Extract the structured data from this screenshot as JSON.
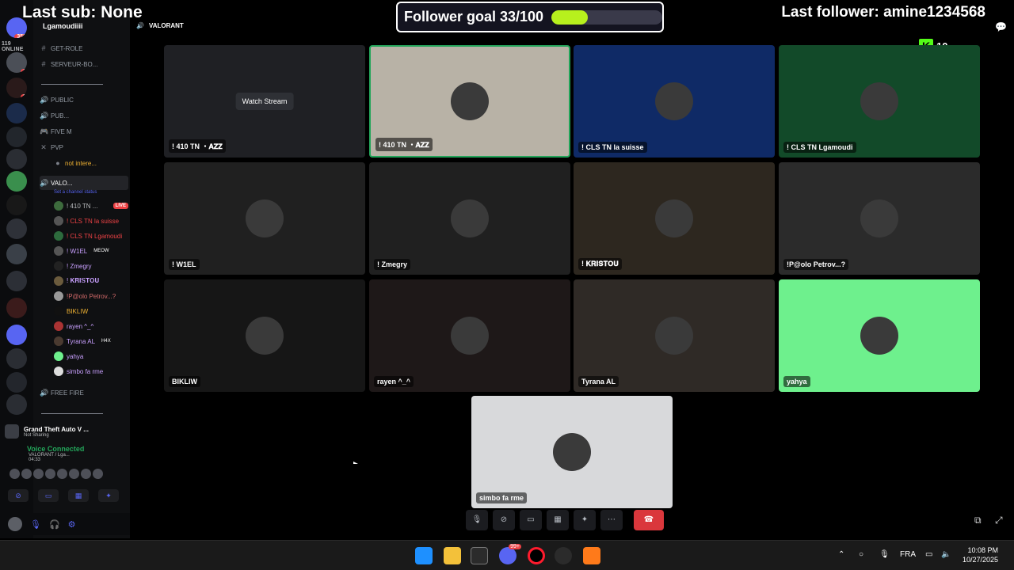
{
  "overlay": {
    "last_sub": "Last sub: None",
    "last_follower": "Last follower: amine1234568",
    "follower_goal": "Follower goal 33/100",
    "goal_progress": 0.33,
    "kick_count": "10"
  },
  "rail": {
    "online_label": "119 ONLINE",
    "top_badge": "359",
    "second_badge": "1",
    "third_badge": "3"
  },
  "server": {
    "name": "Lgamoudiiii"
  },
  "channels": [
    {
      "label": "GET-ROLE"
    },
    {
      "label": "SERVEUR-BO..."
    },
    {
      "label": "PUBLIC"
    },
    {
      "label": "PUB..."
    },
    {
      "label": "FIVE M"
    },
    {
      "label": "PVP"
    },
    {
      "label": "not intere..."
    },
    {
      "label": "VALO..."
    },
    {
      "label": "FREE FIRE"
    }
  ],
  "channel_status": "Set a channel status",
  "members": [
    {
      "name": "! 410 TN ...",
      "tag": "LIVE"
    },
    {
      "name": "! CLS TN la suisse",
      "tag": ""
    },
    {
      "name": "! CLS TN Lgamoudi",
      "tag": ""
    },
    {
      "name": "! W1EL",
      "tag": "MEOW"
    },
    {
      "name": "! Zmegry",
      "tag": ""
    },
    {
      "name": "! 𝐊𝐑𝐈𝐒𝐓𝐎𝐔",
      "tag": ""
    },
    {
      "name": "!P@olo Petrov...?",
      "tag": ""
    },
    {
      "name": "BIKLIW",
      "tag": ""
    },
    {
      "name": "rayen ^_^",
      "tag": ""
    },
    {
      "name": "Tyrana AL",
      "tag": "H4X"
    },
    {
      "name": "yahya",
      "tag": ""
    },
    {
      "name": "simbo fa rme",
      "tag": ""
    }
  ],
  "activity": {
    "title": "Grand Theft Auto V ...",
    "subtitle": "Not Sharing"
  },
  "voice": {
    "status": "Voice Connected",
    "channel": "VALORANT / Lga...",
    "elapsed": "04:33"
  },
  "breadcrumb": {
    "channel": "VALORANT"
  },
  "tiles": [
    {
      "name": "! 410 TN ・𝐀𝐙𝐙",
      "bg": "#1f2024",
      "watch": "Watch Stream"
    },
    {
      "name": "! 410 TN ・𝐀𝐙𝐙",
      "bg": "#b8b2a6",
      "watch": ""
    },
    {
      "name": "! CLS TN la suisse",
      "bg": "#0f2a66",
      "watch": ""
    },
    {
      "name": "! CLS TN Lgamoudi",
      "bg": "#124a29",
      "watch": ""
    },
    {
      "name": "! W1EL",
      "bg": "#202020",
      "watch": ""
    },
    {
      "name": "! Zmegry",
      "bg": "#202020",
      "watch": ""
    },
    {
      "name": "! 𝐊𝐑𝐈𝐒𝐓𝐎𝐔",
      "bg": "#2d271f",
      "watch": ""
    },
    {
      "name": "!P@olo Petrov...?",
      "bg": "#2b2b2b",
      "watch": ""
    },
    {
      "name": "BIKLIW",
      "bg": "#161616",
      "watch": ""
    },
    {
      "name": "rayen ^_^",
      "bg": "#1e1818",
      "watch": ""
    },
    {
      "name": "Tyrana AL",
      "bg": "#2f2a26",
      "watch": ""
    },
    {
      "name": "yahya",
      "bg": "#6ef08d",
      "watch": ""
    },
    {
      "name": "simbo fa rme",
      "bg": "#d8d9db",
      "watch": ""
    }
  ],
  "taskbar": {
    "language": "FRA",
    "time": "10:08 PM",
    "date": "10/27/2025",
    "discord_badge": "99+"
  }
}
